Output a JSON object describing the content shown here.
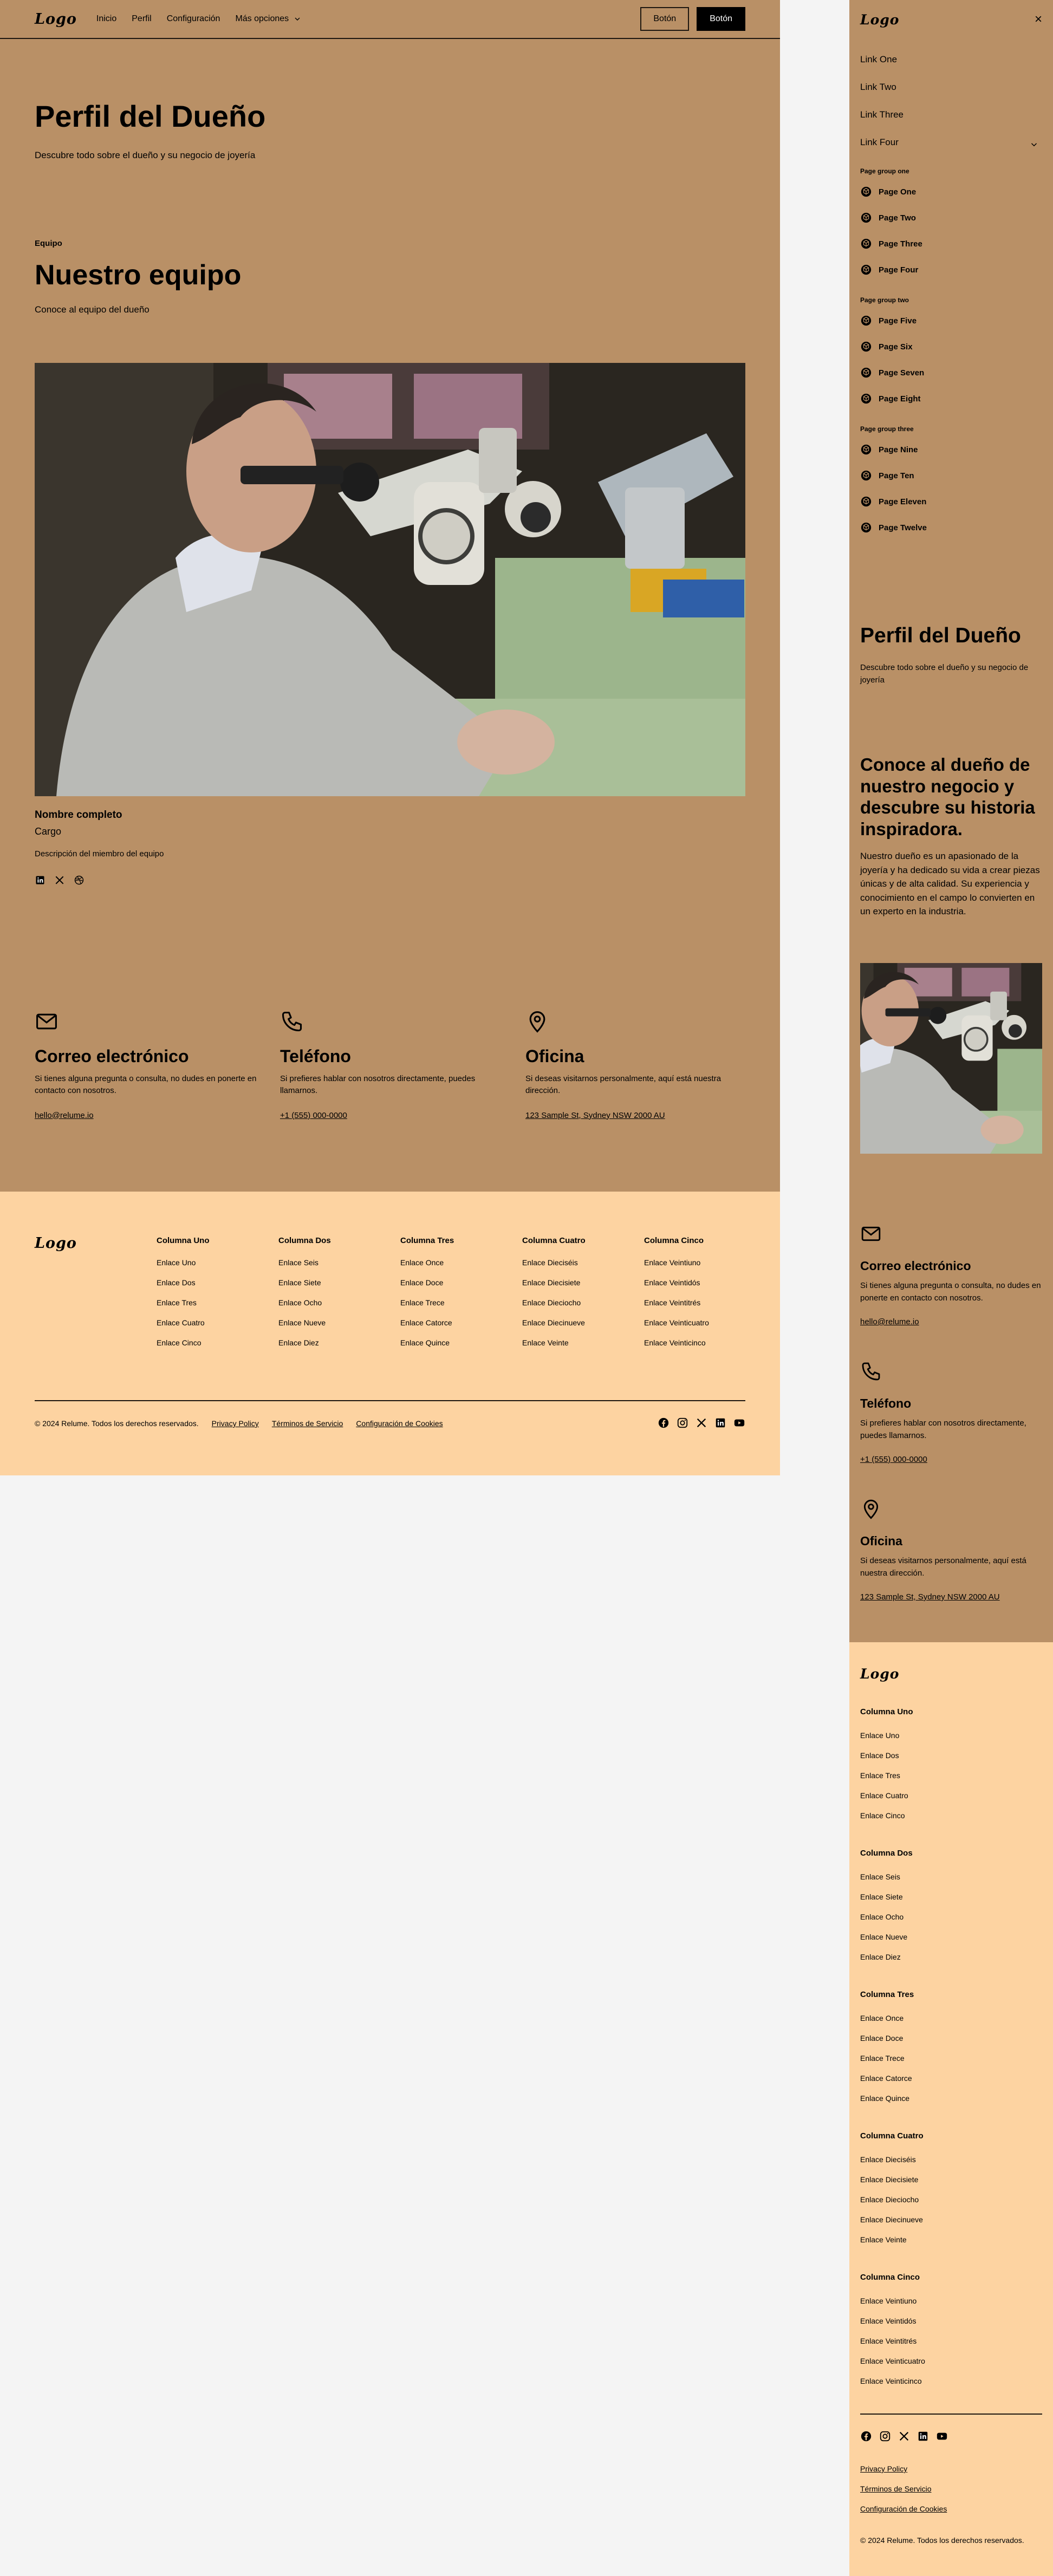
{
  "nav": {
    "logo": "Logo",
    "links": [
      "Inicio",
      "Perfil",
      "Configuración",
      "Más opciones"
    ],
    "button_secondary": "Botón",
    "button_primary": "Botón"
  },
  "hero": {
    "title": "Perfil del Dueño",
    "subtitle": "Descubre todo sobre el dueño y su negocio de joyería"
  },
  "team": {
    "tagline": "Equipo",
    "title": "Nuestro equipo",
    "subtitle": "Conoce al equipo del dueño",
    "member": {
      "name": "Nombre completo",
      "role": "Cargo",
      "description": "Descripción del miembro del equipo",
      "social_icons": [
        "linkedin-icon",
        "x-icon",
        "dribbble-icon"
      ]
    }
  },
  "contact": [
    {
      "icon": "mail-icon",
      "title": "Correo electrónico",
      "text": "Si tienes alguna pregunta o consulta, no dudes en ponerte en contacto con nosotros.",
      "link": "hello@relume.io"
    },
    {
      "icon": "phone-icon",
      "title": "Teléfono",
      "text": "Si prefieres hablar con nosotros directamente, puedes llamarnos.",
      "link": "+1 (555) 000-0000"
    },
    {
      "icon": "map-pin-icon",
      "title": "Oficina",
      "text": "Si deseas visitarnos personalmente, aquí está nuestra dirección.",
      "link": "123 Sample St, Sydney NSW 2000 AU"
    }
  ],
  "footer": {
    "logo": "Logo",
    "columns": [
      {
        "title": "Columna Uno",
        "links": [
          "Enlace Uno",
          "Enlace Dos",
          "Enlace Tres",
          "Enlace Cuatro",
          "Enlace Cinco"
        ]
      },
      {
        "title": "Columna Dos",
        "links": [
          "Enlace Seis",
          "Enlace Siete",
          "Enlace Ocho",
          "Enlace Nueve",
          "Enlace Diez"
        ]
      },
      {
        "title": "Columna Tres",
        "links": [
          "Enlace Once",
          "Enlace Doce",
          "Enlace Trece",
          "Enlace Catorce",
          "Enlace Quince"
        ]
      },
      {
        "title": "Columna Cuatro",
        "links": [
          "Enlace Dieciséis",
          "Enlace Diecisiete",
          "Enlace Dieciocho",
          "Enlace Diecinueve",
          "Enlace Veinte"
        ]
      },
      {
        "title": "Columna Cinco",
        "links": [
          "Enlace Veintiuno",
          "Enlace Veintidós",
          "Enlace Veintitrés",
          "Enlace Veinticuatro",
          "Enlace Veinticinco"
        ]
      }
    ],
    "copyright": "© 2024 Relume. Todos los derechos reservados.",
    "legal_links": [
      "Privacy Policy",
      "Términos de Servicio",
      "Configuración de Cookies"
    ],
    "social_icons": [
      "facebook-icon",
      "instagram-icon",
      "x-icon",
      "linkedin-icon",
      "youtube-icon"
    ]
  },
  "mobile_menu": {
    "close_label": "×",
    "links": [
      "Link One",
      "Link Two",
      "Link Three",
      "Link Four"
    ],
    "groups": [
      {
        "title": "Page group one",
        "pages": [
          "Page One",
          "Page Two",
          "Page Three",
          "Page Four"
        ]
      },
      {
        "title": "Page group two",
        "pages": [
          "Page Five",
          "Page Six",
          "Page Seven",
          "Page Eight"
        ]
      },
      {
        "title": "Page group three",
        "pages": [
          "Page Nine",
          "Page Ten",
          "Page Eleven",
          "Page Twelve"
        ]
      }
    ]
  },
  "mobile_intro": {
    "title": "Conoce al dueño de nuestro negocio y descubre su historia inspiradora.",
    "text": "Nuestro dueño es un apasionado de la joyería y ha dedicado su vida a crear piezas únicas y de alta calidad. Su experiencia y conocimiento en el campo lo convierten en un experto en la industria."
  },
  "colors": {
    "background": "#b99066",
    "footer": "#fdd3a1",
    "text": "#000000"
  }
}
